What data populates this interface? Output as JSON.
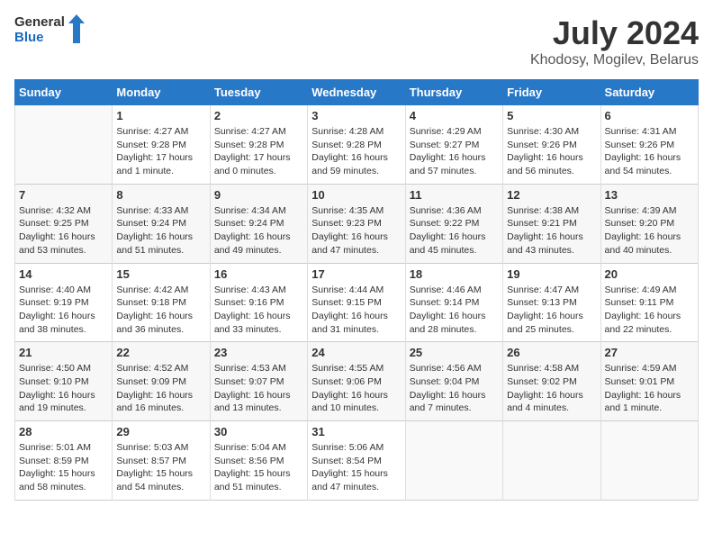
{
  "logo": {
    "general": "General",
    "blue": "Blue"
  },
  "title": "July 2024",
  "location": "Khodosy, Mogilev, Belarus",
  "weekdays": [
    "Sunday",
    "Monday",
    "Tuesday",
    "Wednesday",
    "Thursday",
    "Friday",
    "Saturday"
  ],
  "weeks": [
    [
      {
        "day": "",
        "info": ""
      },
      {
        "day": "1",
        "info": "Sunrise: 4:27 AM\nSunset: 9:28 PM\nDaylight: 17 hours\nand 1 minute."
      },
      {
        "day": "2",
        "info": "Sunrise: 4:27 AM\nSunset: 9:28 PM\nDaylight: 17 hours\nand 0 minutes."
      },
      {
        "day": "3",
        "info": "Sunrise: 4:28 AM\nSunset: 9:28 PM\nDaylight: 16 hours\nand 59 minutes."
      },
      {
        "day": "4",
        "info": "Sunrise: 4:29 AM\nSunset: 9:27 PM\nDaylight: 16 hours\nand 57 minutes."
      },
      {
        "day": "5",
        "info": "Sunrise: 4:30 AM\nSunset: 9:26 PM\nDaylight: 16 hours\nand 56 minutes."
      },
      {
        "day": "6",
        "info": "Sunrise: 4:31 AM\nSunset: 9:26 PM\nDaylight: 16 hours\nand 54 minutes."
      }
    ],
    [
      {
        "day": "7",
        "info": "Sunrise: 4:32 AM\nSunset: 9:25 PM\nDaylight: 16 hours\nand 53 minutes."
      },
      {
        "day": "8",
        "info": "Sunrise: 4:33 AM\nSunset: 9:24 PM\nDaylight: 16 hours\nand 51 minutes."
      },
      {
        "day": "9",
        "info": "Sunrise: 4:34 AM\nSunset: 9:24 PM\nDaylight: 16 hours\nand 49 minutes."
      },
      {
        "day": "10",
        "info": "Sunrise: 4:35 AM\nSunset: 9:23 PM\nDaylight: 16 hours\nand 47 minutes."
      },
      {
        "day": "11",
        "info": "Sunrise: 4:36 AM\nSunset: 9:22 PM\nDaylight: 16 hours\nand 45 minutes."
      },
      {
        "day": "12",
        "info": "Sunrise: 4:38 AM\nSunset: 9:21 PM\nDaylight: 16 hours\nand 43 minutes."
      },
      {
        "day": "13",
        "info": "Sunrise: 4:39 AM\nSunset: 9:20 PM\nDaylight: 16 hours\nand 40 minutes."
      }
    ],
    [
      {
        "day": "14",
        "info": "Sunrise: 4:40 AM\nSunset: 9:19 PM\nDaylight: 16 hours\nand 38 minutes."
      },
      {
        "day": "15",
        "info": "Sunrise: 4:42 AM\nSunset: 9:18 PM\nDaylight: 16 hours\nand 36 minutes."
      },
      {
        "day": "16",
        "info": "Sunrise: 4:43 AM\nSunset: 9:16 PM\nDaylight: 16 hours\nand 33 minutes."
      },
      {
        "day": "17",
        "info": "Sunrise: 4:44 AM\nSunset: 9:15 PM\nDaylight: 16 hours\nand 31 minutes."
      },
      {
        "day": "18",
        "info": "Sunrise: 4:46 AM\nSunset: 9:14 PM\nDaylight: 16 hours\nand 28 minutes."
      },
      {
        "day": "19",
        "info": "Sunrise: 4:47 AM\nSunset: 9:13 PM\nDaylight: 16 hours\nand 25 minutes."
      },
      {
        "day": "20",
        "info": "Sunrise: 4:49 AM\nSunset: 9:11 PM\nDaylight: 16 hours\nand 22 minutes."
      }
    ],
    [
      {
        "day": "21",
        "info": "Sunrise: 4:50 AM\nSunset: 9:10 PM\nDaylight: 16 hours\nand 19 minutes."
      },
      {
        "day": "22",
        "info": "Sunrise: 4:52 AM\nSunset: 9:09 PM\nDaylight: 16 hours\nand 16 minutes."
      },
      {
        "day": "23",
        "info": "Sunrise: 4:53 AM\nSunset: 9:07 PM\nDaylight: 16 hours\nand 13 minutes."
      },
      {
        "day": "24",
        "info": "Sunrise: 4:55 AM\nSunset: 9:06 PM\nDaylight: 16 hours\nand 10 minutes."
      },
      {
        "day": "25",
        "info": "Sunrise: 4:56 AM\nSunset: 9:04 PM\nDaylight: 16 hours\nand 7 minutes."
      },
      {
        "day": "26",
        "info": "Sunrise: 4:58 AM\nSunset: 9:02 PM\nDaylight: 16 hours\nand 4 minutes."
      },
      {
        "day": "27",
        "info": "Sunrise: 4:59 AM\nSunset: 9:01 PM\nDaylight: 16 hours\nand 1 minute."
      }
    ],
    [
      {
        "day": "28",
        "info": "Sunrise: 5:01 AM\nSunset: 8:59 PM\nDaylight: 15 hours\nand 58 minutes."
      },
      {
        "day": "29",
        "info": "Sunrise: 5:03 AM\nSunset: 8:57 PM\nDaylight: 15 hours\nand 54 minutes."
      },
      {
        "day": "30",
        "info": "Sunrise: 5:04 AM\nSunset: 8:56 PM\nDaylight: 15 hours\nand 51 minutes."
      },
      {
        "day": "31",
        "info": "Sunrise: 5:06 AM\nSunset: 8:54 PM\nDaylight: 15 hours\nand 47 minutes."
      },
      {
        "day": "",
        "info": ""
      },
      {
        "day": "",
        "info": ""
      },
      {
        "day": "",
        "info": ""
      }
    ]
  ]
}
